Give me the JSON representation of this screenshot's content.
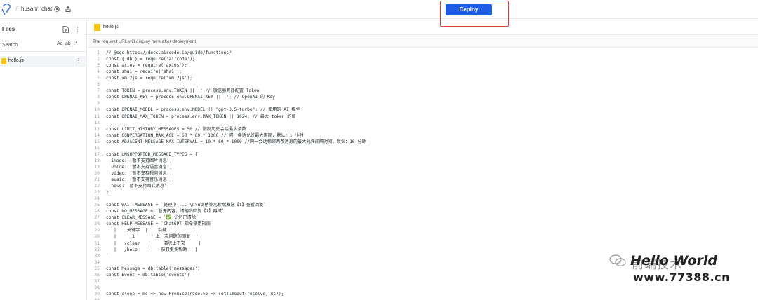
{
  "header": {
    "breadcrumb": [
      "husanr",
      "chat"
    ],
    "deploy_label": "Deploy"
  },
  "sidebar": {
    "title": "Files",
    "search_placeholder": "Search",
    "search_options": [
      "Aa",
      "ab",
      ".*"
    ],
    "files": [
      {
        "name": "hello.js",
        "selected": true
      }
    ]
  },
  "editor": {
    "tab_label": "hello.js",
    "url_notice": "The request URL will display here after deployment",
    "lines": [
      {
        "n": "1",
        "text": "// @see https://docs.aircode.io/guide/functions/"
      },
      {
        "n": "2",
        "text": "const { db } = require('aircode');"
      },
      {
        "n": "3",
        "text": "const axios = require('axios');"
      },
      {
        "n": "4",
        "text": "const sha1 = require('sha1');"
      },
      {
        "n": "5",
        "text": "const xml2js = require('xml2js');"
      },
      {
        "n": "6",
        "text": ""
      },
      {
        "n": "7",
        "text": "const TOKEN = process.env.TOKEN || '' // 微信服务器配置 Token"
      },
      {
        "n": "8",
        "text": "const OPENAI_KEY = process.env.OPENAI_KEY || ''; // OpenAI 的 Key"
      },
      {
        "n": "9",
        "text": ""
      },
      {
        "n": "10",
        "text": "const OPENAI_MODEL = process.env.MODEL || \"gpt-3.5-turbo\"; // 使用的 AI 模型"
      },
      {
        "n": "11",
        "text": "const OPENAI_MAX_TOKEN = process.env.MAX_TOKEN || 1024; // 最大 token 的值"
      },
      {
        "n": "12",
        "text": ""
      },
      {
        "n": "13",
        "text": "const LIMIT_HISTORY_MESSAGES = 50 // 限制历史会话最大条数"
      },
      {
        "n": "14",
        "text": "const CONVERSATION_MAX_AGE = 60 * 60 * 1000 // 同一会话允许最大周期，默认：1 小时"
      },
      {
        "n": "15",
        "text": "const ADJACENT_MESSAGE_MAX_INTERVAL = 10 * 60 * 1000 //同一会话相邻两条消息的最大允许间隔时间，默认：10 分钟"
      },
      {
        "n": "16",
        "text": ""
      },
      {
        "n": "17",
        "text": "const UNSUPPORTED_MESSAGE_TYPES = {",
        "fold": "⌄"
      },
      {
        "n": "18",
        "text": "  image: '暂不支持图片消息',",
        "fold": ""
      },
      {
        "n": "19",
        "text": "  voice: '暂不支持语音消息',",
        "fold": ""
      },
      {
        "n": "20",
        "text": "  video: '暂不支持视频消息',",
        "fold": ""
      },
      {
        "n": "21",
        "text": "  music: '暂不支持音乐消息',",
        "fold": ""
      },
      {
        "n": "22",
        "text": "  news: '暂不支持图文消息',",
        "fold": ""
      },
      {
        "n": "23",
        "text": "}",
        "fold": ""
      },
      {
        "n": "24",
        "text": ""
      },
      {
        "n": "25",
        "text": "const WAIT_MESSAGE = `处理中 ... \\n\\n请稍等几秒后发送【1】查看回复`"
      },
      {
        "n": "26",
        "text": "const NO_MESSAGE = `暂无内容，请稍后回复【1】再试`"
      },
      {
        "n": "27",
        "text": "const CLEAR_MESSAGE = `✅ 记忆已清除`"
      },
      {
        "n": "28",
        "text": "const HELP_MESSAGE = `ChatGPT 指令使用指南"
      },
      {
        "n": "29",
        "text": "   |    关键字  |    功能         |"
      },
      {
        "n": "30",
        "text": "   |      1      | 上一次问题的回复  |"
      },
      {
        "n": "31",
        "text": "   |   /clear   |     清除上下文     |"
      },
      {
        "n": "32",
        "text": "   |   /help    |    获取更多帮助   |"
      },
      {
        "n": "33",
        "text": "`"
      },
      {
        "n": "34",
        "text": ""
      },
      {
        "n": "35",
        "text": "const Message = db.table('messages')"
      },
      {
        "n": "36",
        "text": "const Event = db.table('events')"
      },
      {
        "n": "37",
        "text": ""
      },
      {
        "n": "38",
        "text": ""
      },
      {
        "n": "39",
        "text": "const sleep = ms => new Promise(resolve => setTimeout(resolve, ms));"
      },
      {
        "n": "40",
        "text": ""
      }
    ]
  },
  "watermark": {
    "cn_text": "前端技术",
    "hello_text": "Hello World",
    "url_text": "www.77388.cn"
  },
  "colors": {
    "deploy_button": "#1f5ce6",
    "highlight_box": "#e53935",
    "file_icon": "#f5c518"
  }
}
